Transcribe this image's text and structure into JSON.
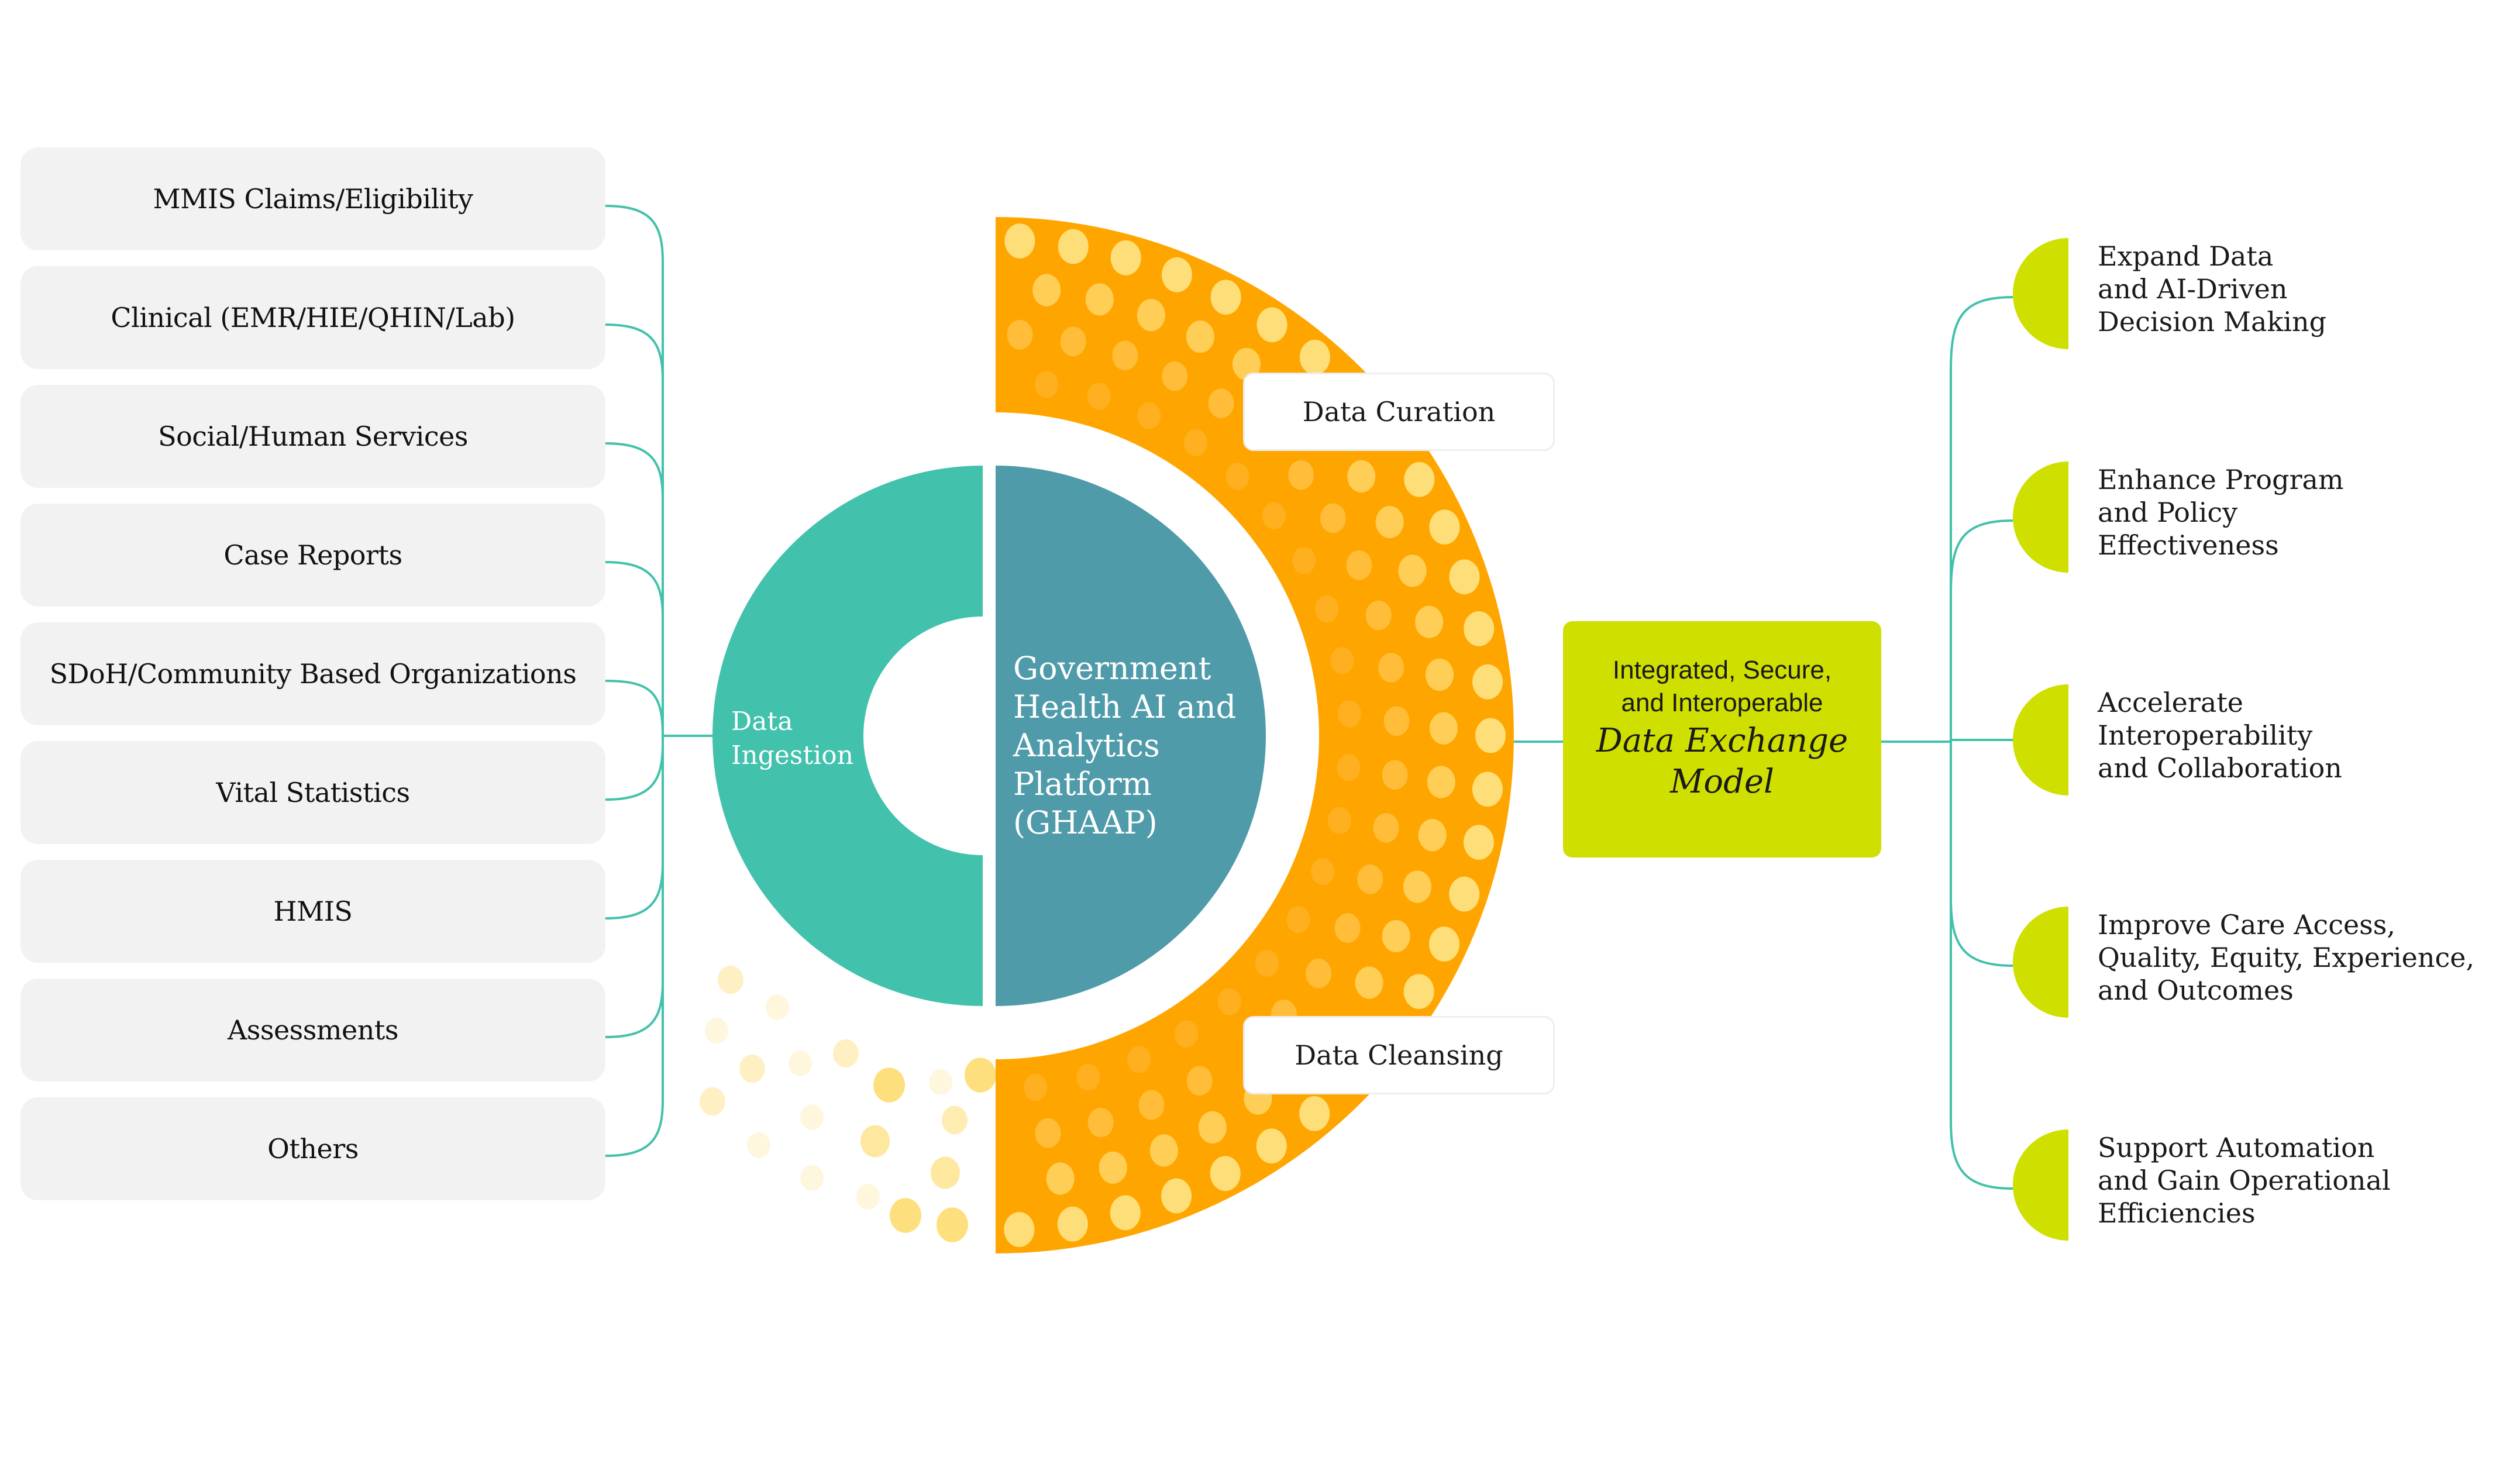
{
  "colors": {
    "connector": "#42c1ac",
    "ingestion": "#42c1ac",
    "core": "#4f9ba9",
    "ring": "#ffa500",
    "exchange": "#cfdf00",
    "outcome_marker": "#cfdf00",
    "source_box": "#f2f2f2",
    "ring_dot_rows": [
      "#fede78",
      "#ffce57",
      "#ffbd3a",
      "#ffb020"
    ]
  },
  "sources": [
    {
      "label": "MMIS Claims/Eligibility"
    },
    {
      "label": "Clinical (EMR/HIE/QHIN/Lab)"
    },
    {
      "label": "Social/Human Services"
    },
    {
      "label": "Case Reports"
    },
    {
      "label": "SDoH/Community Based Organizations"
    },
    {
      "label": "Vital Statistics"
    },
    {
      "label": "HMIS"
    },
    {
      "label": "Assessments"
    },
    {
      "label": "Others"
    }
  ],
  "ingestion": {
    "label_line1": "Data",
    "label_line2": "Ingestion"
  },
  "core": {
    "lines": [
      "Government",
      "Health AI and",
      "Analytics",
      "Platform",
      "(GHAAP)"
    ]
  },
  "stages": [
    {
      "label": "Data Curation"
    },
    {
      "label": "Data Cleansing"
    }
  ],
  "exchange": {
    "subtitle_line1": "Integrated, Secure,",
    "subtitle_line2": "and Interoperable",
    "title_line1": "Data Exchange",
    "title_line2": "Model"
  },
  "outcomes": [
    {
      "text": "Expand Data\nand AI-Driven\nDecision Making"
    },
    {
      "text": "Enhance Program\nand Policy\nEffectiveness"
    },
    {
      "text": "Accelerate\nInteroperability\nand Collaboration"
    },
    {
      "text": "Improve Care Access,\nQuality, Equity, Experience,\nand Outcomes"
    },
    {
      "text": "Support Automation\nand Gain Operational\nEfficiencies"
    }
  ]
}
